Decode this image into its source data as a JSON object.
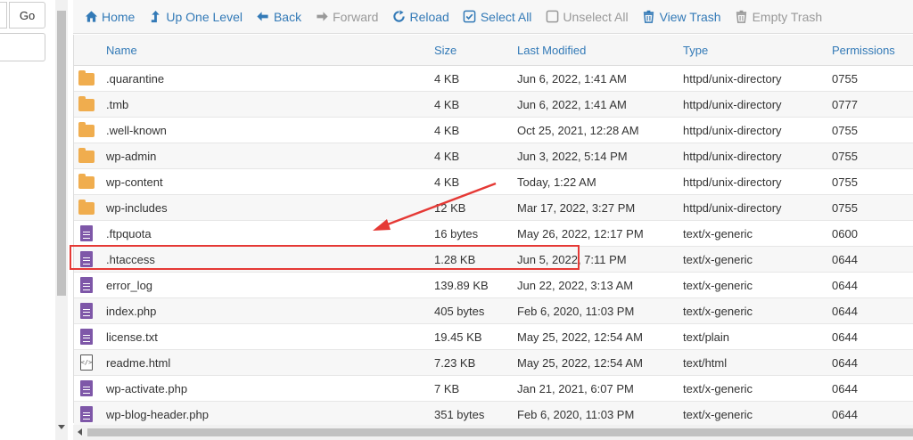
{
  "left_pane": {
    "go_label": "Go"
  },
  "toolbar": {
    "home": "Home",
    "up_one_level": "Up One Level",
    "back": "Back",
    "forward": "Forward",
    "reload": "Reload",
    "select_all": "Select All",
    "unselect_all": "Unselect All",
    "view_trash": "View Trash",
    "empty_trash": "Empty Trash"
  },
  "columns": [
    "Name",
    "Size",
    "Last Modified",
    "Type",
    "Permissions"
  ],
  "files": [
    {
      "icon": "folder-icon",
      "name": ".quarantine",
      "size": "4 KB",
      "modified": "Jun 6, 2022, 1:41 AM",
      "type": "httpd/unix-directory",
      "perm": "0755"
    },
    {
      "icon": "folder-icon",
      "name": ".tmb",
      "size": "4 KB",
      "modified": "Jun 6, 2022, 1:41 AM",
      "type": "httpd/unix-directory",
      "perm": "0777"
    },
    {
      "icon": "folder-icon",
      "name": ".well-known",
      "size": "4 KB",
      "modified": "Oct 25, 2021, 12:28 AM",
      "type": "httpd/unix-directory",
      "perm": "0755"
    },
    {
      "icon": "folder-icon",
      "name": "wp-admin",
      "size": "4 KB",
      "modified": "Jun 3, 2022, 5:14 PM",
      "type": "httpd/unix-directory",
      "perm": "0755"
    },
    {
      "icon": "folder-icon",
      "name": "wp-content",
      "size": "4 KB",
      "modified": "Today, 1:22 AM",
      "type": "httpd/unix-directory",
      "perm": "0755"
    },
    {
      "icon": "folder-icon",
      "name": "wp-includes",
      "size": "12 KB",
      "modified": "Mar 17, 2022, 3:27 PM",
      "type": "httpd/unix-directory",
      "perm": "0755"
    },
    {
      "icon": "file-icon",
      "name": ".ftpquota",
      "size": "16 bytes",
      "modified": "May 26, 2022, 12:17 PM",
      "type": "text/x-generic",
      "perm": "0600"
    },
    {
      "icon": "file-icon",
      "name": ".htaccess",
      "size": "1.28 KB",
      "modified": "Jun 5, 2022, 7:11 PM",
      "type": "text/x-generic",
      "perm": "0644"
    },
    {
      "icon": "file-icon",
      "name": "error_log",
      "size": "139.89 KB",
      "modified": "Jun 22, 2022, 3:13 AM",
      "type": "text/x-generic",
      "perm": "0644"
    },
    {
      "icon": "file-icon",
      "name": "index.php",
      "size": "405 bytes",
      "modified": "Feb 6, 2020, 11:03 PM",
      "type": "text/x-generic",
      "perm": "0644"
    },
    {
      "icon": "file-icon",
      "name": "license.txt",
      "size": "19.45 KB",
      "modified": "May 25, 2022, 12:54 AM",
      "type": "text/plain",
      "perm": "0644"
    },
    {
      "icon": "html-file-icon",
      "name": "readme.html",
      "size": "7.23 KB",
      "modified": "May 25, 2022, 12:54 AM",
      "type": "text/html",
      "perm": "0644"
    },
    {
      "icon": "file-icon",
      "name": "wp-activate.php",
      "size": "7 KB",
      "modified": "Jan 21, 2021, 6:07 PM",
      "type": "text/x-generic",
      "perm": "0644"
    },
    {
      "icon": "file-icon",
      "name": "wp-blog-header.php",
      "size": "351 bytes",
      "modified": "Feb 6, 2020, 11:03 PM",
      "type": "text/x-generic",
      "perm": "0644"
    }
  ],
  "highlighted_file": ".htaccess",
  "colors": {
    "link": "#337ab7",
    "folder": "#f0ad4e",
    "file": "#7e57a8",
    "annotation": "#e53935"
  }
}
